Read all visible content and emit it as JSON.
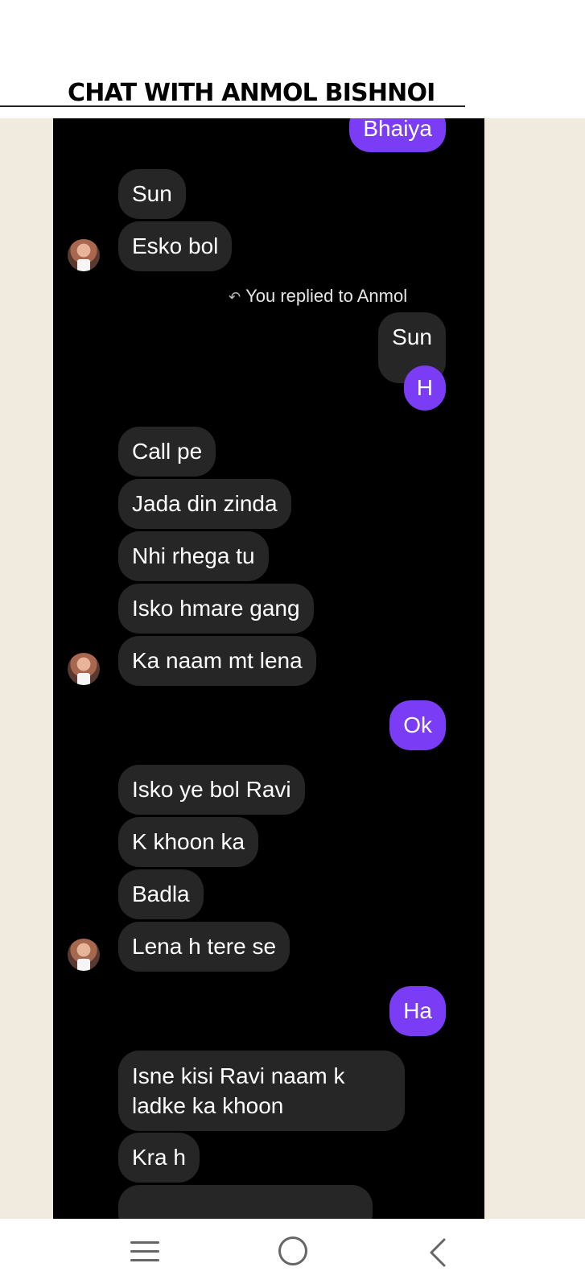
{
  "header": {
    "title": "CHAT WITH ANMOL BISHNOI"
  },
  "chat": {
    "top_sent": "Bhaiya",
    "msg1": "Sun",
    "msg2": "Esko bol",
    "reply_note": "You replied to Anmol",
    "quoted": "Sun",
    "reply_sent": "H",
    "msg3": "Call pe",
    "msg4": "Jada din zinda",
    "msg5": "Nhi rhega tu",
    "msg6": "Isko hmare gang",
    "msg7": "Ka naam mt lena",
    "sent_ok": "Ok",
    "msg8": "Isko ye bol Ravi",
    "msg9": "K khoon ka",
    "msg10": "Badla",
    "msg11": "Lena h tere se",
    "sent_ha": "Ha",
    "msg12": "Isne kisi Ravi naam k ladke ka khoon",
    "msg13": "Kra h"
  },
  "colors": {
    "sent_bubble": "#7a3cf5",
    "received_bubble": "#262626",
    "chat_bg": "#000000",
    "side_bg": "#f0eadf"
  },
  "icons": {
    "nav": [
      "menu-icon",
      "home-icon",
      "back-icon"
    ],
    "reply": "reply-arrow-icon"
  }
}
